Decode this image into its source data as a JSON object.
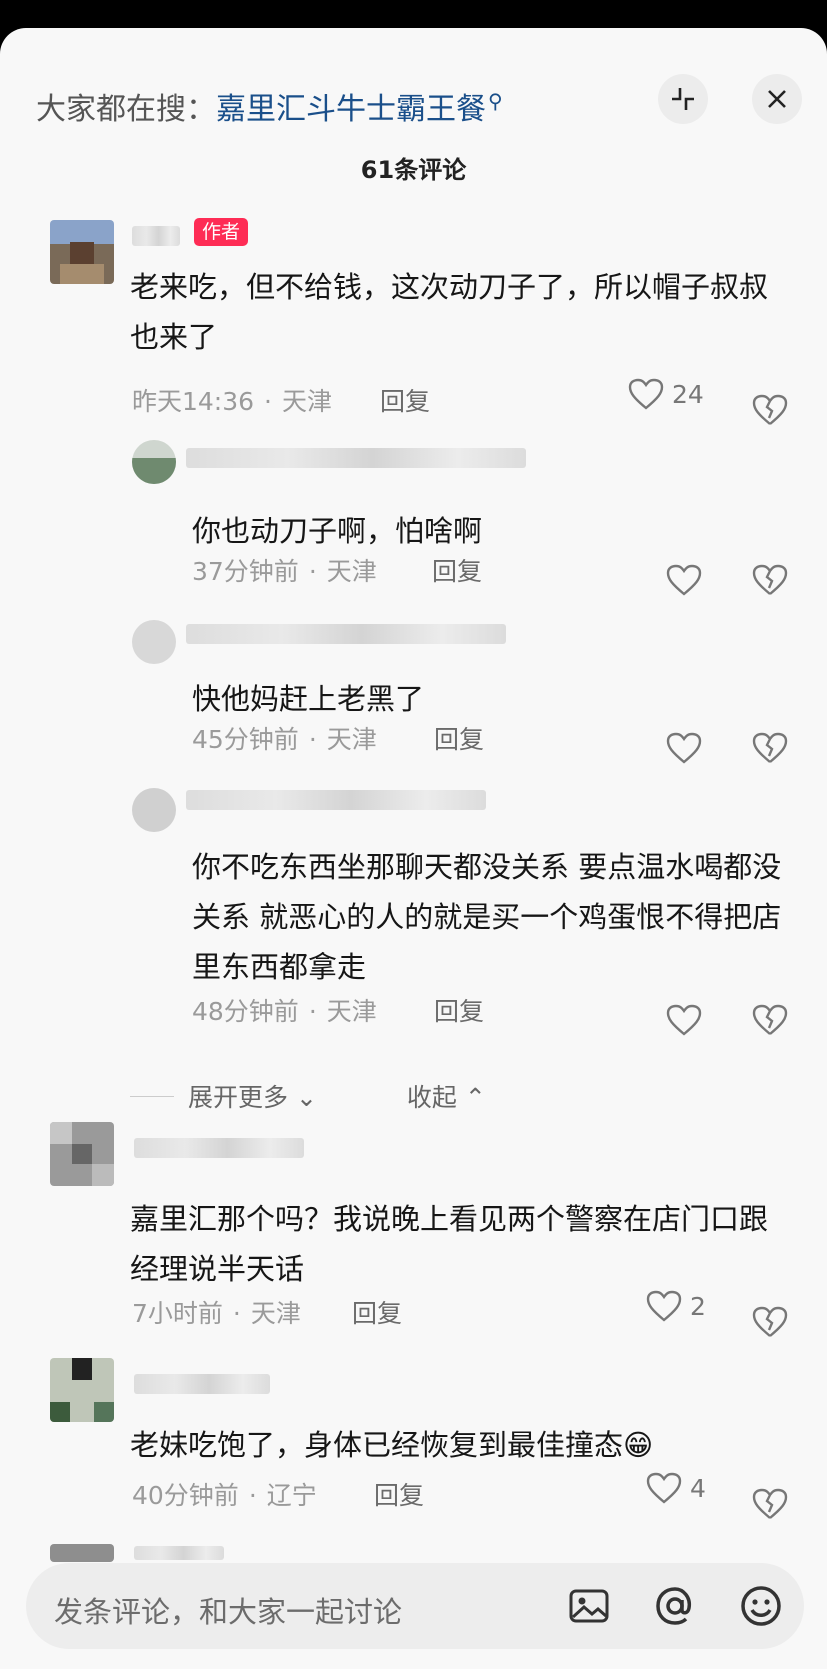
{
  "header": {
    "search_prefix": "大家都在搜：",
    "search_keyword": "嘉里汇斗牛士霸王餐",
    "comment_count": "61条评论"
  },
  "labels": {
    "author_badge": "作者",
    "reply": "回复",
    "expand_more": "展开更多",
    "collapse": "收起",
    "input_placeholder": "发条评论，和大家一起讨论",
    "dot": "·"
  },
  "comments": [
    {
      "text": "老来吃，但不给钱，这次动刀子了，所以帽子叔叔也来了",
      "time": "昨天14:36",
      "location": "天津",
      "likes": "24",
      "replies": [
        {
          "text": "你也动刀子啊，怕啥啊",
          "time": "37分钟前",
          "location": "天津"
        },
        {
          "text": "快他妈赶上老黑了",
          "time": "45分钟前",
          "location": "天津"
        },
        {
          "text": "你不吃东西坐那聊天都没关系  要点温水喝都没关系   就恶心的人的就是买一个鸡蛋恨不得把店里东西都拿走",
          "time": "48分钟前",
          "location": "天津"
        }
      ]
    },
    {
      "text": "嘉里汇那个吗？我说晚上看见两个警察在店门口跟经理说半天话",
      "time": "7小时前",
      "location": "天津",
      "likes": "2"
    },
    {
      "text": "老妹吃饱了，身体已经恢复到最佳撞态😁",
      "time": "40分钟前",
      "location": "辽宁",
      "likes": "4"
    }
  ],
  "icons": [
    "collapse-icon",
    "close-icon",
    "heart-icon",
    "broken-heart-icon",
    "image-icon",
    "at-icon",
    "emoji-icon"
  ],
  "colors": {
    "badge": "#fe2c55",
    "keyword": "#1a4f8a"
  }
}
